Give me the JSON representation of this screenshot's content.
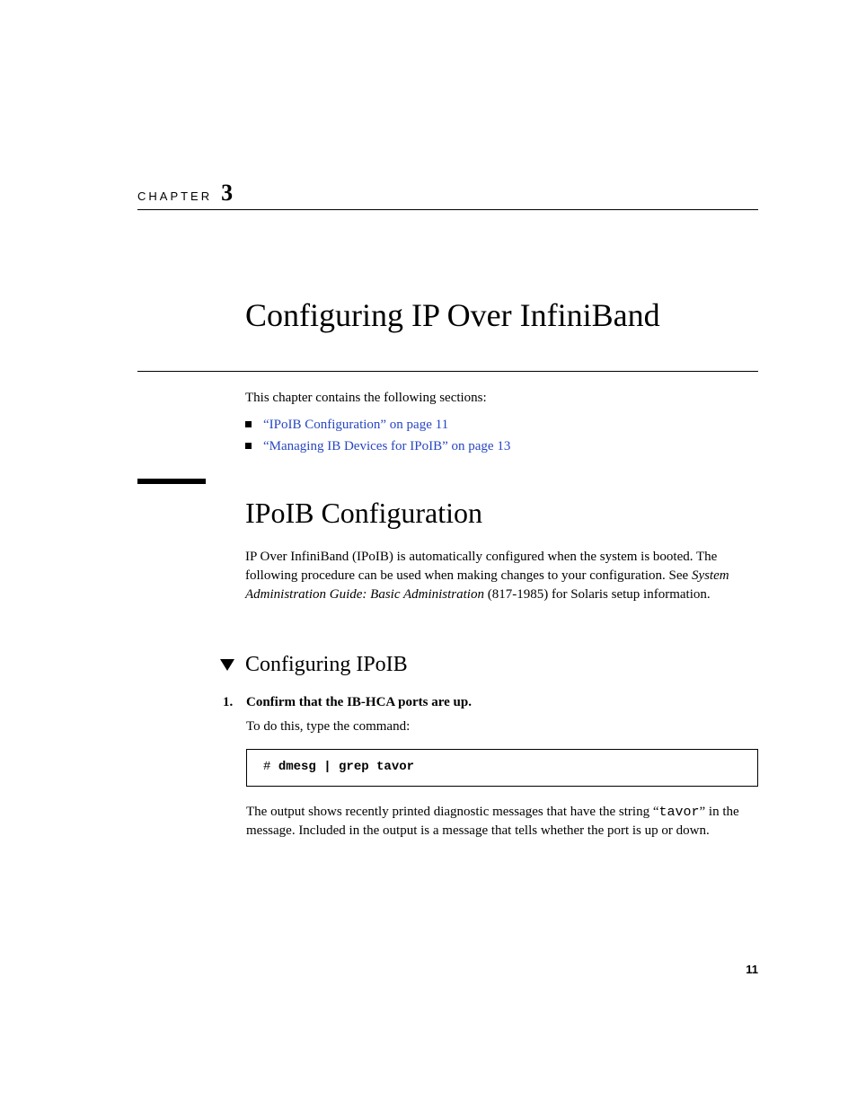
{
  "chapter": {
    "label": "CHAPTER",
    "number": "3"
  },
  "title": "Configuring IP Over InfiniBand",
  "intro": {
    "lead": "This chapter contains the following sections:",
    "links": [
      "“IPoIB Configuration” on page 11",
      "“Managing IB Devices for IPoIB” on page 13"
    ]
  },
  "section": {
    "heading": "IPoIB Configuration",
    "body_pre": "IP Over InfiniBand (IPoIB) is automatically configured when the system is booted. The following procedure can be used when making changes to your configuration. See ",
    "body_em": "System Administration Guide: Basic Administration",
    "body_post": " (817-1985) for Solaris setup information."
  },
  "subsection": {
    "heading": "Configuring IPoIB"
  },
  "step1": {
    "num": "1.",
    "title": "Confirm that the IB-HCA ports are up.",
    "lead": "To do this, type the command:",
    "prompt": "# ",
    "command": "dmesg | grep tavor",
    "result_pre": "The output shows recently printed diagnostic messages that have the string “",
    "result_code": "tavor",
    "result_post": "” in the message. Included in the output is a message that tells whether the port is up or down."
  },
  "page_number": "11"
}
